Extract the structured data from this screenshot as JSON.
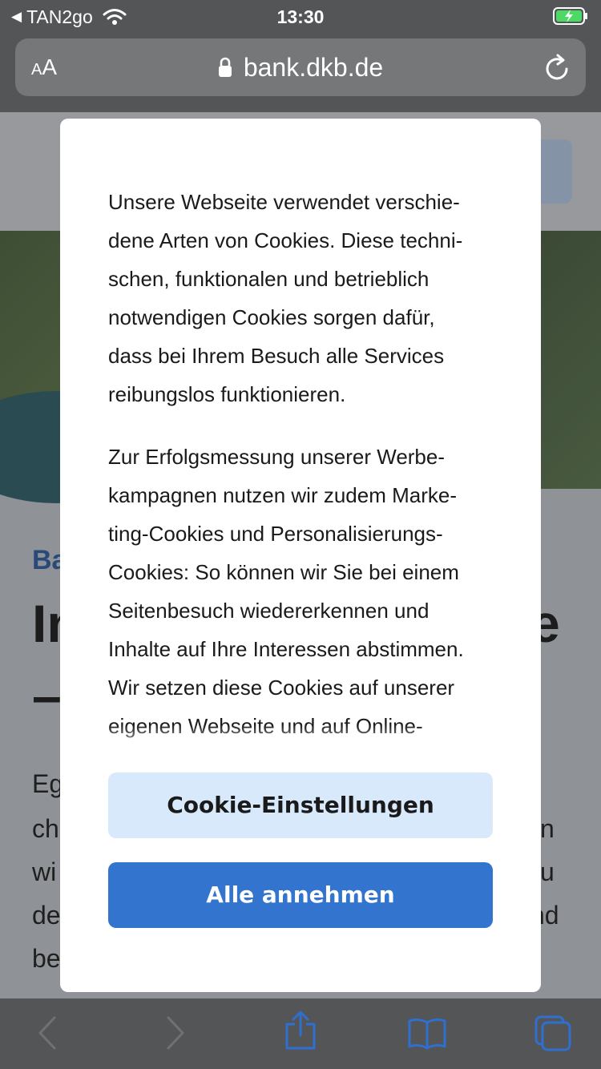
{
  "status_bar": {
    "back_indicator": "◀",
    "back_app": "TAN2go",
    "time": "13:30",
    "battery_state": "charging"
  },
  "address_bar": {
    "text_size_small": "A",
    "text_size_large": "A",
    "url": "bank.dkb.de"
  },
  "page_behind": {
    "kicker": "Ba",
    "heading_left": "In",
    "heading_right": "e",
    "heading_line2": "–",
    "lines": [
      {
        "left": "Eg",
        "right": ""
      },
      {
        "left": "ch",
        "right": "n"
      },
      {
        "left": "wi",
        "right": "u"
      },
      {
        "left": "de",
        "right": "nd"
      },
      {
        "left": "be",
        "right": ""
      }
    ]
  },
  "cookie_modal": {
    "paragraphs": [
      "Unsere Webseite verwendet verschie-\ndene Arten von Cookies. Diese techni-\nschen, funktionalen und betrieblich\nnotwendigen Cookies sorgen dafür,\ndass bei Ihrem Besuch alle Services\nreibungslos funktionieren.",
      "Zur Erfolgsmessung unserer Werbe-\nkampagnen nutzen wir zudem Marke-\nting-Cookies und Personalisierungs-\nCookies: So können wir Sie bei einem\nSeitenbesuch wiedererkennen und\nInhalte auf Ihre Interessen abstimmen.\nWir setzen diese Cookies auf unserer\neigenen Webseite und auf Online-"
    ],
    "settings_button": "Cookie-Einstellungen",
    "accept_button": "Alle annehmen"
  },
  "colors": {
    "accent": "#3374CF",
    "accent_light": "#D7E9FB",
    "toolbar_icon": "#2E6FD0",
    "overlay": "#535557"
  },
  "toolbar": {
    "icons": [
      "back-arrow-icon",
      "forward-arrow-icon",
      "share-icon",
      "bookmarks-icon",
      "tabs-icon"
    ]
  }
}
